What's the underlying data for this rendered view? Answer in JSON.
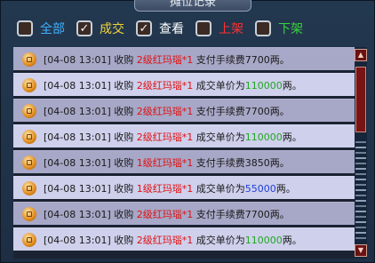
{
  "window": {
    "title": "摊位记录"
  },
  "filters": [
    {
      "label": "全部",
      "checked": false,
      "color": "#3fb0ff"
    },
    {
      "label": "成交",
      "checked": true,
      "color": "#f2d23a"
    },
    {
      "label": "查看",
      "checked": true,
      "color": "#ffffff"
    },
    {
      "label": "上架",
      "checked": false,
      "color": "#ff3030"
    },
    {
      "label": "下架",
      "checked": false,
      "color": "#3ad23a"
    }
  ],
  "records": [
    {
      "time": "[04-08 13:01]",
      "action": "收购",
      "item": "2级红玛瑙*1",
      "prefix": "支付手续费",
      "amount": "7700",
      "suffix": "两。",
      "amount_color": "default"
    },
    {
      "time": "[04-08 13:01]",
      "action": "收购",
      "item": "2级红玛瑙*1",
      "prefix": "成交单价为",
      "amount": "110000",
      "suffix": "两。",
      "amount_color": "green"
    },
    {
      "time": "[04-08 13:01]",
      "action": "收购",
      "item": "2级红玛瑙*1",
      "prefix": "支付手续费",
      "amount": "7700",
      "suffix": "两。",
      "amount_color": "default"
    },
    {
      "time": "[04-08 13:01]",
      "action": "收购",
      "item": "2级红玛瑙*1",
      "prefix": "成交单价为",
      "amount": "110000",
      "suffix": "两。",
      "amount_color": "green"
    },
    {
      "time": "[04-08 13:01]",
      "action": "收购",
      "item": "1级红玛瑙*1",
      "prefix": "支付手续费",
      "amount": "3850",
      "suffix": "两。",
      "amount_color": "default"
    },
    {
      "time": "[04-08 13:01]",
      "action": "收购",
      "item": "1级红玛瑙*1",
      "prefix": "成交单价为",
      "amount": "55000",
      "suffix": "两。",
      "amount_color": "blue"
    },
    {
      "time": "[04-08 13:01]",
      "action": "收购",
      "item": "2级红玛瑙*1",
      "prefix": "支付手续费",
      "amount": "7700",
      "suffix": "两。",
      "amount_color": "default"
    },
    {
      "time": "[04-08 13:01]",
      "action": "收购",
      "item": "2级红玛瑙*1",
      "prefix": "成交单价为",
      "amount": "110000",
      "suffix": "两。",
      "amount_color": "green"
    }
  ],
  "scrollbar": {
    "up_icon": "arrow-up-icon",
    "down_icon": "arrow-down-icon"
  }
}
